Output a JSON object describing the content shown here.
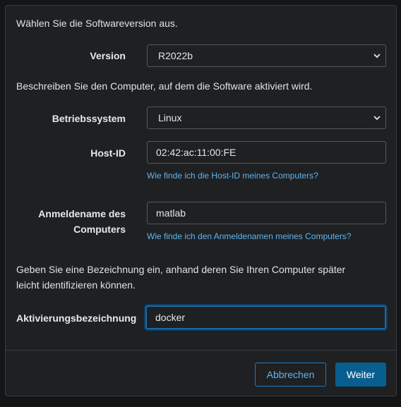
{
  "section1": {
    "intro": "Wählen Sie die Softwareversion aus."
  },
  "version": {
    "label": "Version",
    "value": "R2022b"
  },
  "section2": {
    "intro": "Beschreiben Sie den Computer, auf dem die Software aktiviert wird."
  },
  "os": {
    "label": "Betriebssystem",
    "value": "Linux"
  },
  "hostid": {
    "label": "Host-ID",
    "value": "02:42:ac:11:00:FE",
    "help_link": "Wie finde ich die Host-ID meines Computers?"
  },
  "login": {
    "label_line1": "Anmeldename des",
    "label_line2": "Computers",
    "value": "matlab",
    "help_link": "Wie finde ich den Anmeldenamen meines Computers?"
  },
  "section3": {
    "intro_line1": "Geben Sie eine Bezeichnung ein, anhand deren Sie Ihren Computer später",
    "intro_line2": "leicht identifizieren können."
  },
  "activation": {
    "label": "Aktivierungsbezeichnung",
    "value": "docker"
  },
  "buttons": {
    "cancel": "Abbrechen",
    "next": "Weiter"
  },
  "icons": {
    "dropdown": "chevron-down-icon"
  },
  "colors": {
    "link": "#5fb4f0",
    "primary": "#085f8f",
    "focus": "#1a6aa5"
  }
}
